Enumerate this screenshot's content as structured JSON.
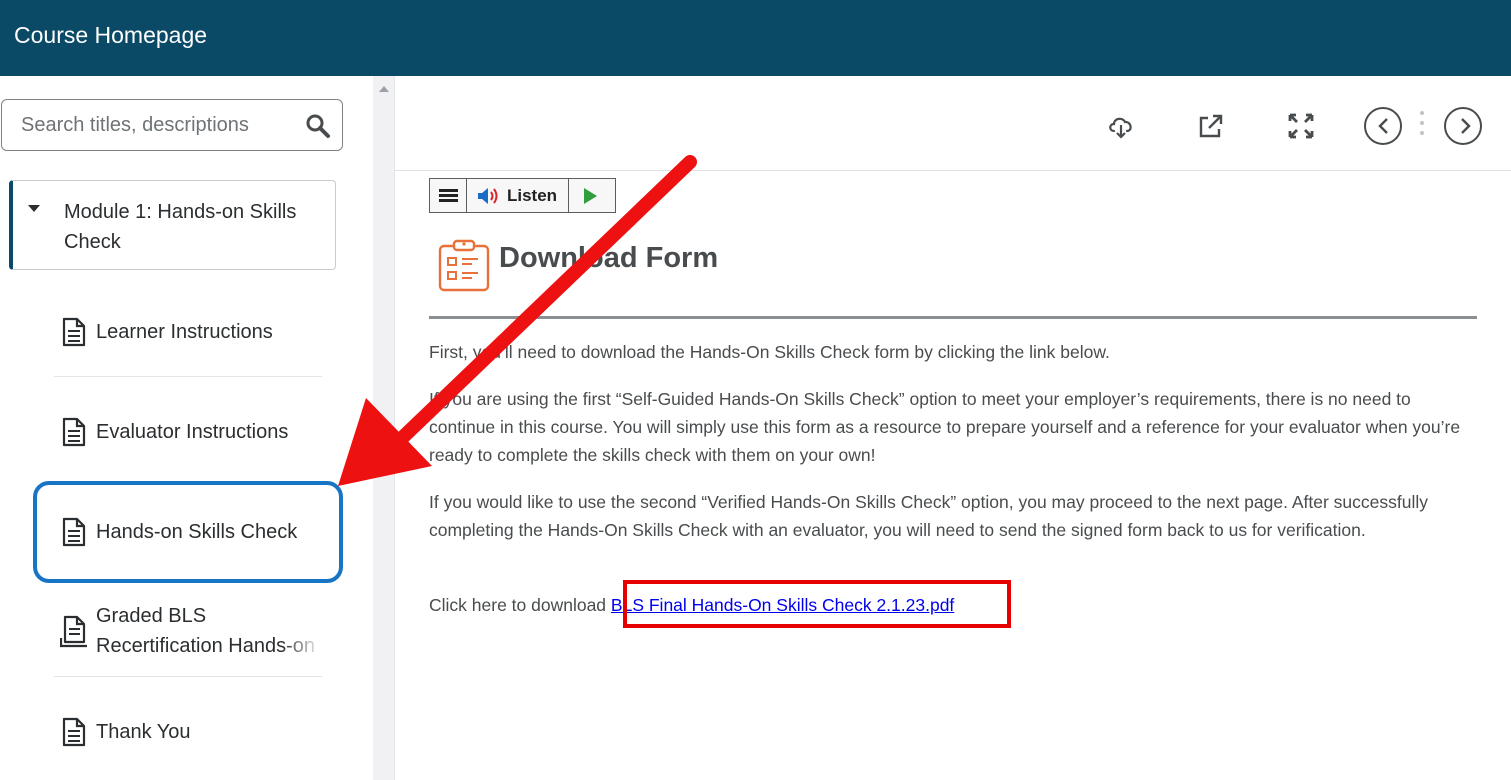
{
  "header": {
    "title": "Course Homepage"
  },
  "search": {
    "placeholder": "Search titles, descriptions"
  },
  "module": {
    "label": "Module 1: Hands-on Skills Check"
  },
  "items": [
    {
      "label": "Learner Instructions"
    },
    {
      "label": "Evaluator Instructions"
    },
    {
      "label": "Hands-on Skills Check"
    },
    {
      "label": "Graded BLS Recertification Hands-on Skills Check"
    },
    {
      "label": "Thank You"
    }
  ],
  "listen": {
    "label": "Listen"
  },
  "content": {
    "heading": "Download Form",
    "para1": "First, you’ll need to download the Hands-On Skills Check form by clicking the link below.",
    "para2": "If you are using the first “Self-Guided Hands-On Skills Check” option to meet your employer’s requirements, there is no need to continue in this course. You will simply use this form as a resource to prepare yourself and a reference for your evaluator when you’re ready to complete the skills check with them on your own!",
    "para3": "If you would like to use the second “Verified Hands-On Skills Check” option, you may proceed to the next page. After successfully completing the Hands-On Skills Check with an evaluator, you will need to send the signed form back to us for verification.",
    "download_prefix": "Click here to download",
    "download_link": "BLS Final Hands-On Skills Check 2.1.23.pdf"
  },
  "colors": {
    "header": "#0b4a66",
    "selected": "#1874c4",
    "highlight": "#e60000",
    "arrow": "#ee1111",
    "form_icon": "#e8703a"
  }
}
